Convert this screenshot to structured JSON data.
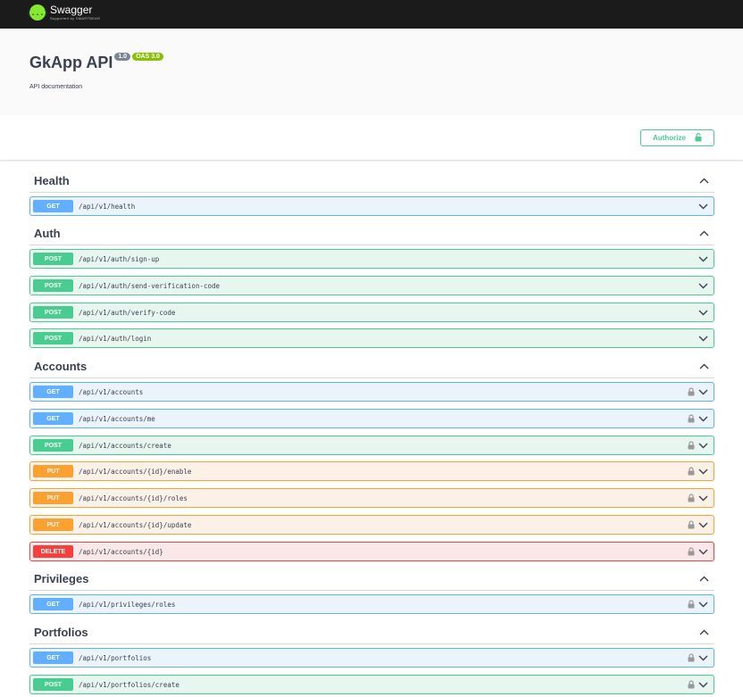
{
  "topbar": {
    "logo_mark": "{...}",
    "logo_title": "Swagger",
    "logo_subtitle": "Supported by SMARTBEAR"
  },
  "info": {
    "title": "GkApp API",
    "version": "1.0",
    "oas": "OAS 3.0",
    "description": "API documentation"
  },
  "authorize_label": "Authorize",
  "colors": {
    "get": "#61affe",
    "post": "#49cc90",
    "put": "#fca130",
    "delete": "#f93e3e",
    "topbar": "#1b1b1b",
    "logo": "#85ea2d"
  },
  "tags": [
    {
      "name": "Health",
      "expanded": true,
      "operations": [
        {
          "method": "GET",
          "path": "/api/v1/health",
          "locked": false
        }
      ]
    },
    {
      "name": "Auth",
      "expanded": true,
      "operations": [
        {
          "method": "POST",
          "path": "/api/v1/auth/sign-up",
          "locked": false
        },
        {
          "method": "POST",
          "path": "/api/v1/auth/send-verification-code",
          "locked": false
        },
        {
          "method": "POST",
          "path": "/api/v1/auth/verify-code",
          "locked": false
        },
        {
          "method": "POST",
          "path": "/api/v1/auth/login",
          "locked": false
        }
      ]
    },
    {
      "name": "Accounts",
      "expanded": true,
      "operations": [
        {
          "method": "GET",
          "path": "/api/v1/accounts",
          "locked": true
        },
        {
          "method": "GET",
          "path": "/api/v1/accounts/me",
          "locked": true
        },
        {
          "method": "POST",
          "path": "/api/v1/accounts/create",
          "locked": true
        },
        {
          "method": "PUT",
          "path": "/api/v1/accounts/{id}/enable",
          "locked": true
        },
        {
          "method": "PUT",
          "path": "/api/v1/accounts/{id}/roles",
          "locked": true
        },
        {
          "method": "PUT",
          "path": "/api/v1/accounts/{id}/update",
          "locked": true
        },
        {
          "method": "DELETE",
          "path": "/api/v1/accounts/{id}",
          "locked": true
        }
      ]
    },
    {
      "name": "Privileges",
      "expanded": true,
      "operations": [
        {
          "method": "GET",
          "path": "/api/v1/privileges/roles",
          "locked": true
        }
      ]
    },
    {
      "name": "Portfolios",
      "expanded": true,
      "operations": [
        {
          "method": "GET",
          "path": "/api/v1/portfolios",
          "locked": true
        },
        {
          "method": "POST",
          "path": "/api/v1/portfolios/create",
          "locked": true
        }
      ]
    }
  ]
}
